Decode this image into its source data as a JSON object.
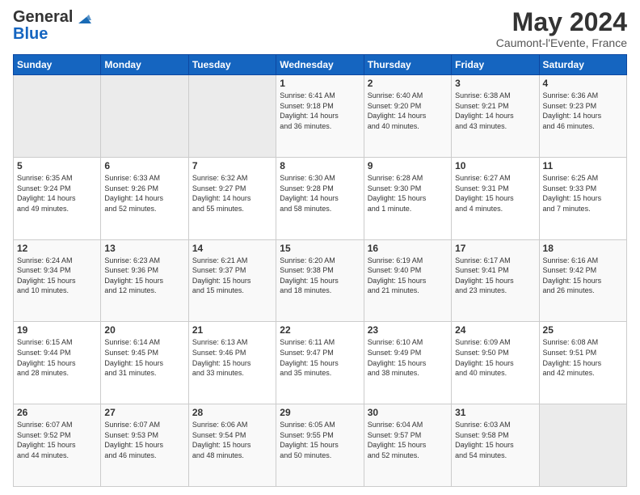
{
  "logo": {
    "general": "General",
    "blue": "Blue"
  },
  "header": {
    "month": "May 2024",
    "location": "Caumont-l'Evente, France"
  },
  "weekdays": [
    "Sunday",
    "Monday",
    "Tuesday",
    "Wednesday",
    "Thursday",
    "Friday",
    "Saturday"
  ],
  "weeks": [
    [
      {
        "day": "",
        "info": ""
      },
      {
        "day": "",
        "info": ""
      },
      {
        "day": "",
        "info": ""
      },
      {
        "day": "1",
        "info": "Sunrise: 6:41 AM\nSunset: 9:18 PM\nDaylight: 14 hours\nand 36 minutes."
      },
      {
        "day": "2",
        "info": "Sunrise: 6:40 AM\nSunset: 9:20 PM\nDaylight: 14 hours\nand 40 minutes."
      },
      {
        "day": "3",
        "info": "Sunrise: 6:38 AM\nSunset: 9:21 PM\nDaylight: 14 hours\nand 43 minutes."
      },
      {
        "day": "4",
        "info": "Sunrise: 6:36 AM\nSunset: 9:23 PM\nDaylight: 14 hours\nand 46 minutes."
      }
    ],
    [
      {
        "day": "5",
        "info": "Sunrise: 6:35 AM\nSunset: 9:24 PM\nDaylight: 14 hours\nand 49 minutes."
      },
      {
        "day": "6",
        "info": "Sunrise: 6:33 AM\nSunset: 9:26 PM\nDaylight: 14 hours\nand 52 minutes."
      },
      {
        "day": "7",
        "info": "Sunrise: 6:32 AM\nSunset: 9:27 PM\nDaylight: 14 hours\nand 55 minutes."
      },
      {
        "day": "8",
        "info": "Sunrise: 6:30 AM\nSunset: 9:28 PM\nDaylight: 14 hours\nand 58 minutes."
      },
      {
        "day": "9",
        "info": "Sunrise: 6:28 AM\nSunset: 9:30 PM\nDaylight: 15 hours\nand 1 minute."
      },
      {
        "day": "10",
        "info": "Sunrise: 6:27 AM\nSunset: 9:31 PM\nDaylight: 15 hours\nand 4 minutes."
      },
      {
        "day": "11",
        "info": "Sunrise: 6:25 AM\nSunset: 9:33 PM\nDaylight: 15 hours\nand 7 minutes."
      }
    ],
    [
      {
        "day": "12",
        "info": "Sunrise: 6:24 AM\nSunset: 9:34 PM\nDaylight: 15 hours\nand 10 minutes."
      },
      {
        "day": "13",
        "info": "Sunrise: 6:23 AM\nSunset: 9:36 PM\nDaylight: 15 hours\nand 12 minutes."
      },
      {
        "day": "14",
        "info": "Sunrise: 6:21 AM\nSunset: 9:37 PM\nDaylight: 15 hours\nand 15 minutes."
      },
      {
        "day": "15",
        "info": "Sunrise: 6:20 AM\nSunset: 9:38 PM\nDaylight: 15 hours\nand 18 minutes."
      },
      {
        "day": "16",
        "info": "Sunrise: 6:19 AM\nSunset: 9:40 PM\nDaylight: 15 hours\nand 21 minutes."
      },
      {
        "day": "17",
        "info": "Sunrise: 6:17 AM\nSunset: 9:41 PM\nDaylight: 15 hours\nand 23 minutes."
      },
      {
        "day": "18",
        "info": "Sunrise: 6:16 AM\nSunset: 9:42 PM\nDaylight: 15 hours\nand 26 minutes."
      }
    ],
    [
      {
        "day": "19",
        "info": "Sunrise: 6:15 AM\nSunset: 9:44 PM\nDaylight: 15 hours\nand 28 minutes."
      },
      {
        "day": "20",
        "info": "Sunrise: 6:14 AM\nSunset: 9:45 PM\nDaylight: 15 hours\nand 31 minutes."
      },
      {
        "day": "21",
        "info": "Sunrise: 6:13 AM\nSunset: 9:46 PM\nDaylight: 15 hours\nand 33 minutes."
      },
      {
        "day": "22",
        "info": "Sunrise: 6:11 AM\nSunset: 9:47 PM\nDaylight: 15 hours\nand 35 minutes."
      },
      {
        "day": "23",
        "info": "Sunrise: 6:10 AM\nSunset: 9:49 PM\nDaylight: 15 hours\nand 38 minutes."
      },
      {
        "day": "24",
        "info": "Sunrise: 6:09 AM\nSunset: 9:50 PM\nDaylight: 15 hours\nand 40 minutes."
      },
      {
        "day": "25",
        "info": "Sunrise: 6:08 AM\nSunset: 9:51 PM\nDaylight: 15 hours\nand 42 minutes."
      }
    ],
    [
      {
        "day": "26",
        "info": "Sunrise: 6:07 AM\nSunset: 9:52 PM\nDaylight: 15 hours\nand 44 minutes."
      },
      {
        "day": "27",
        "info": "Sunrise: 6:07 AM\nSunset: 9:53 PM\nDaylight: 15 hours\nand 46 minutes."
      },
      {
        "day": "28",
        "info": "Sunrise: 6:06 AM\nSunset: 9:54 PM\nDaylight: 15 hours\nand 48 minutes."
      },
      {
        "day": "29",
        "info": "Sunrise: 6:05 AM\nSunset: 9:55 PM\nDaylight: 15 hours\nand 50 minutes."
      },
      {
        "day": "30",
        "info": "Sunrise: 6:04 AM\nSunset: 9:57 PM\nDaylight: 15 hours\nand 52 minutes."
      },
      {
        "day": "31",
        "info": "Sunrise: 6:03 AM\nSunset: 9:58 PM\nDaylight: 15 hours\nand 54 minutes."
      },
      {
        "day": "",
        "info": ""
      }
    ]
  ]
}
